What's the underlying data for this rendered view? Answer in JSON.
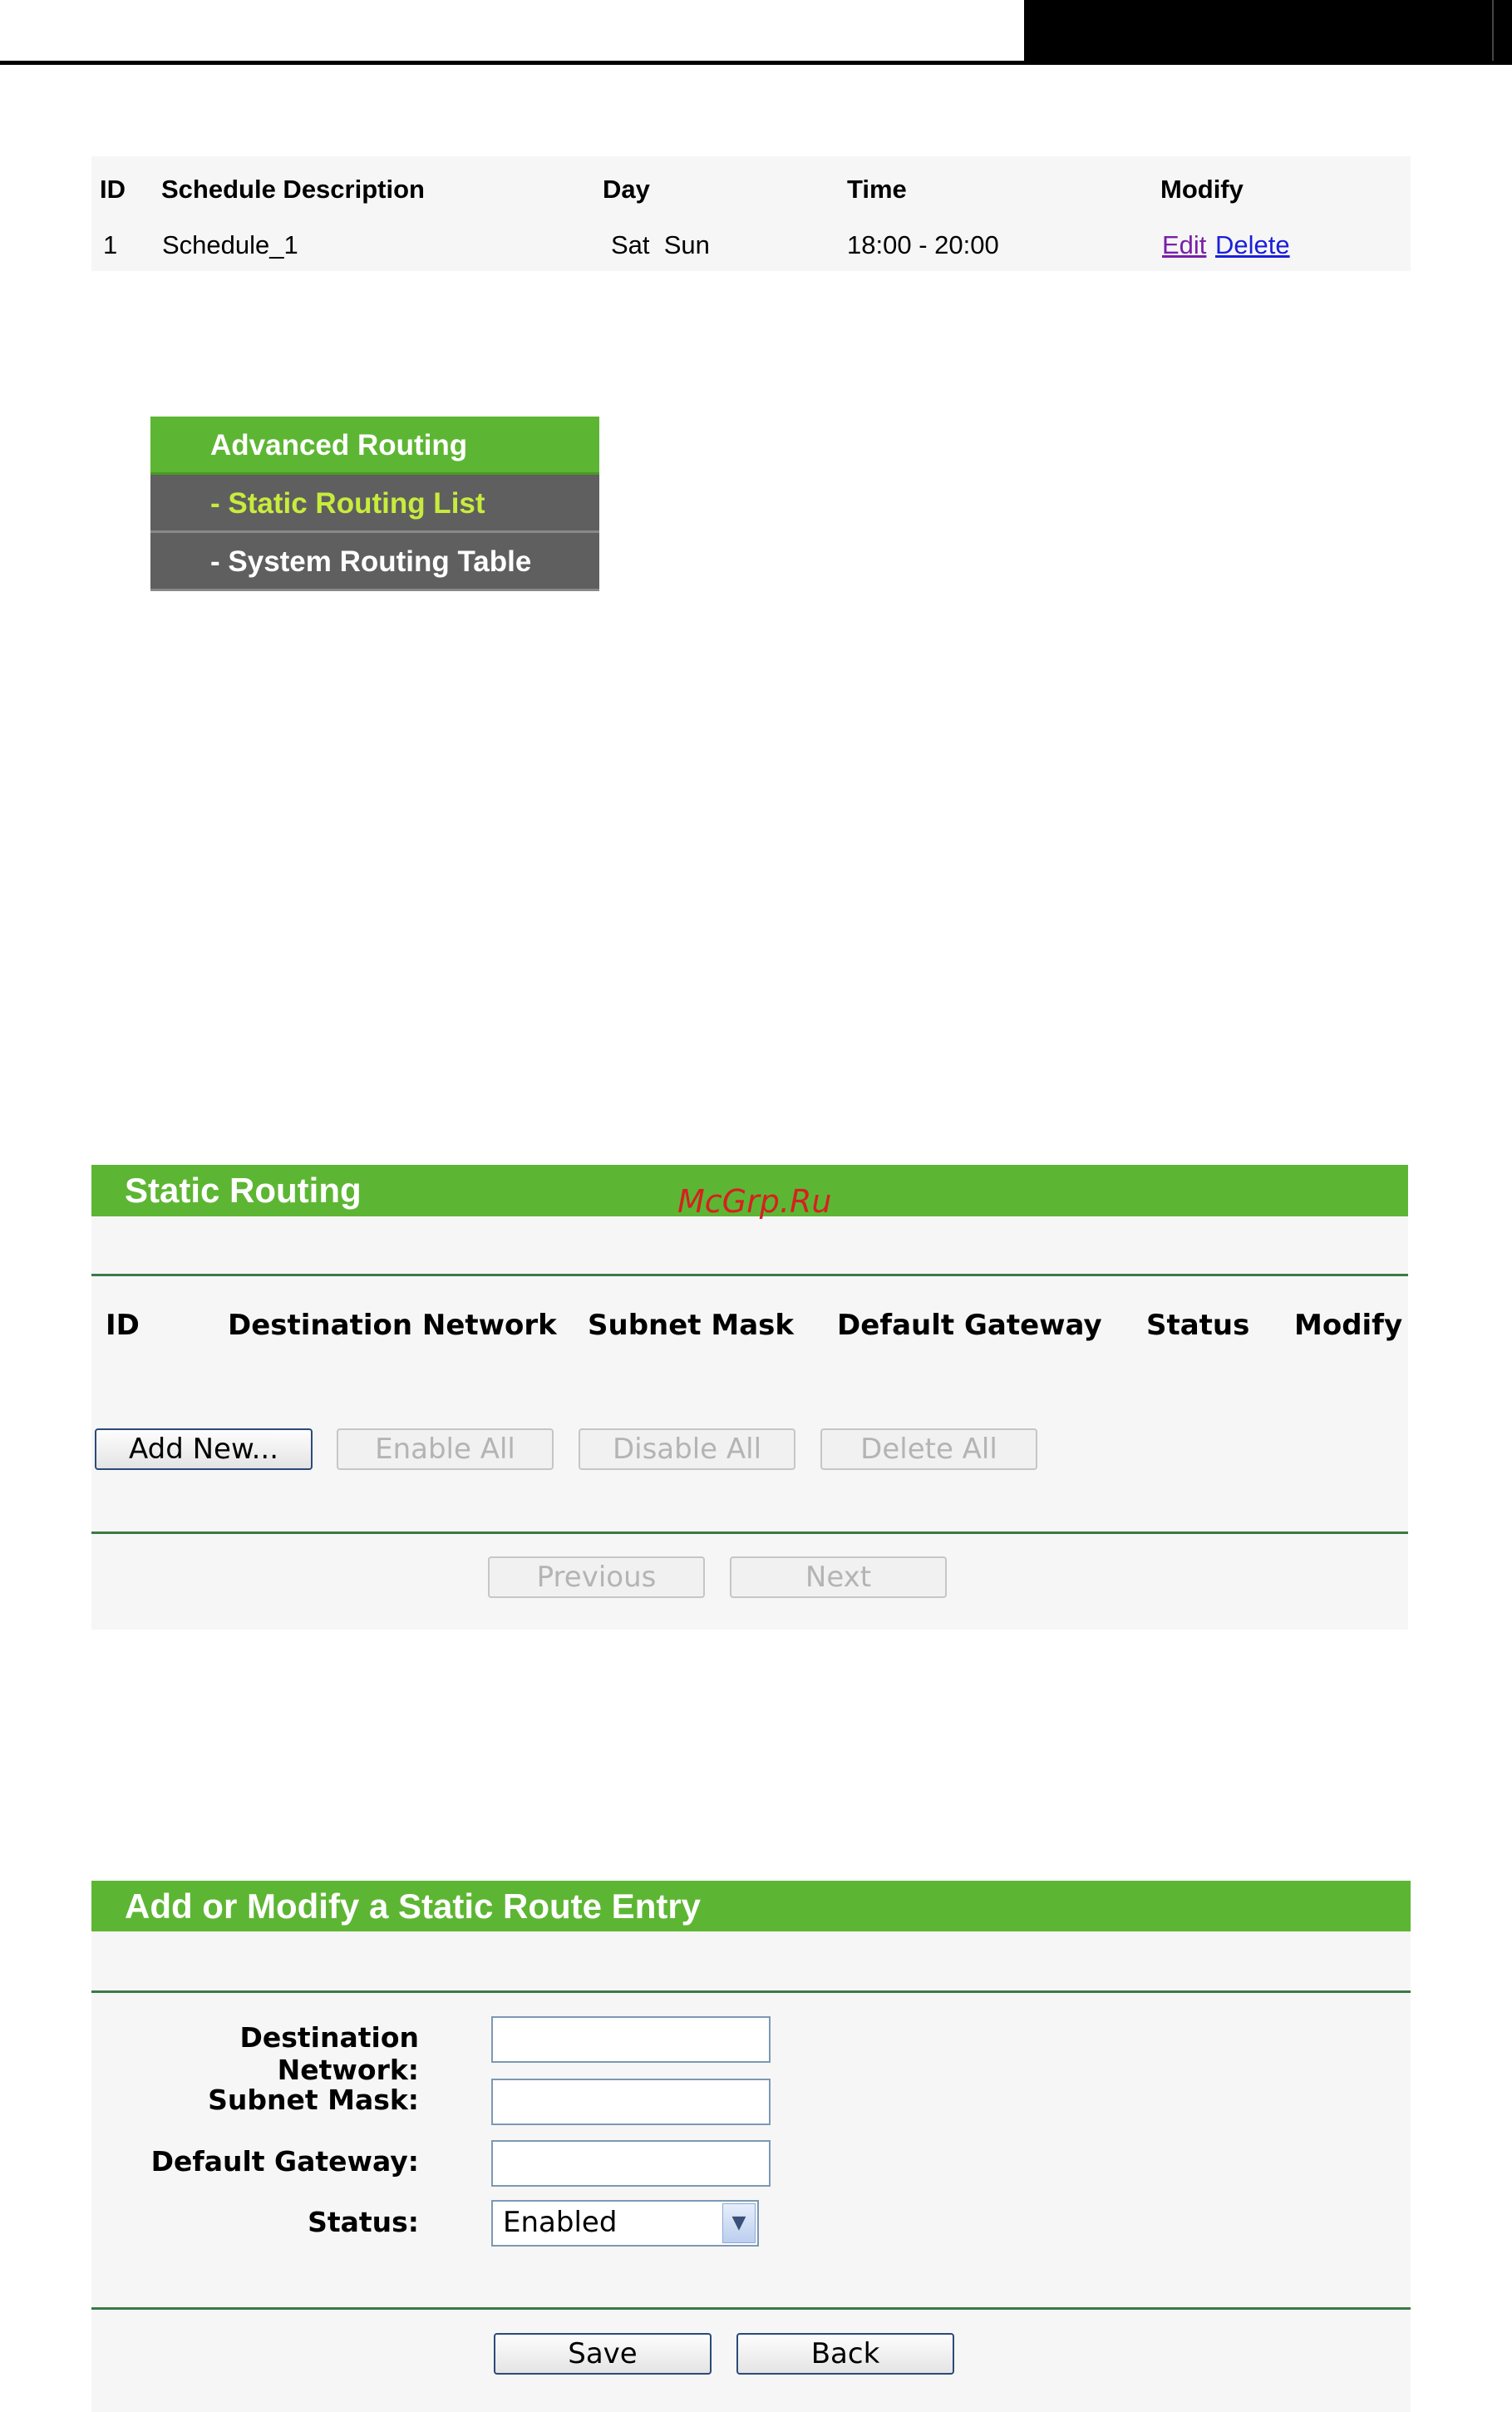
{
  "schedule_table": {
    "headers": [
      "ID",
      "Schedule Description",
      "Day",
      "Time",
      "Modify"
    ],
    "rows": [
      {
        "id": "1",
        "description": "Schedule_1",
        "day": "Sat  Sun",
        "time": "18:00 - 20:00",
        "edit": "Edit",
        "delete": "Delete"
      }
    ]
  },
  "menu": {
    "title": "Advanced Routing",
    "items": [
      "- Static Routing List",
      "- System Routing Table"
    ],
    "active_color": "#c8ec3c"
  },
  "static_routing": {
    "title": "Static Routing",
    "columns": [
      "ID",
      "Destination Network",
      "Subnet Mask",
      "Default Gateway",
      "Status",
      "Modify"
    ],
    "buttons": {
      "add_new": "Add New...",
      "enable_all": "Enable All",
      "disable_all": "Disable All",
      "delete_all": "Delete All"
    },
    "pager": {
      "previous": "Previous",
      "next": "Next"
    }
  },
  "watermark": "McGrp.Ru",
  "route_entry": {
    "title": "Add or Modify a Static Route Entry",
    "destination_label": "Destination Network:",
    "mask_label": "Subnet Mask:",
    "gateway_label": "Default Gateway:",
    "status_label": "Status:",
    "status_value": "Enabled",
    "save": "Save",
    "back": "Back"
  },
  "colors": {
    "header_green": "#5db633",
    "menu_grey": "#5f5f5f",
    "rule_green": "#3a7a46"
  }
}
